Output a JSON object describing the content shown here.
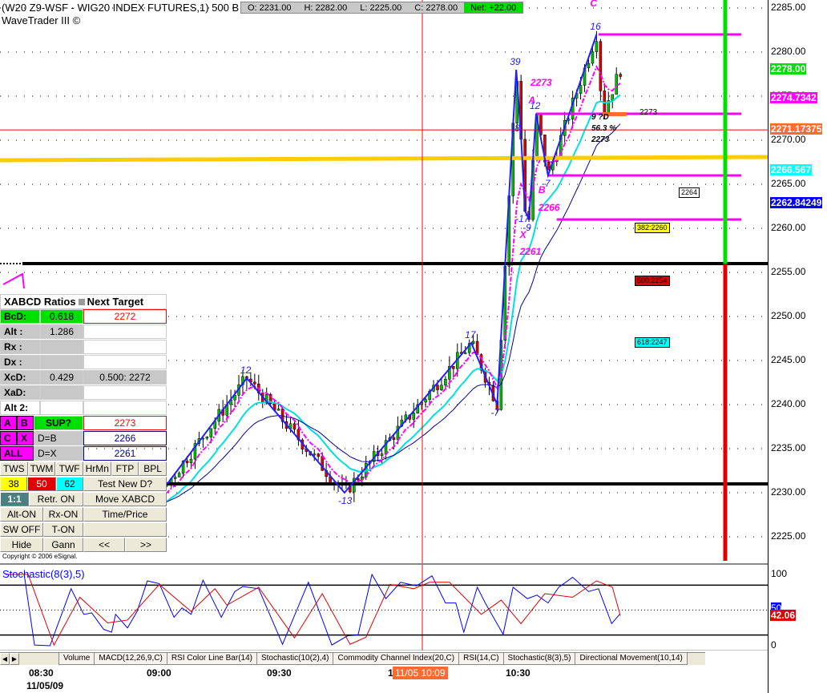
{
  "header": {
    "title": "(W20 Z9-WSF - WIG20 INDEX FUTURES,1) 500 B",
    "subtitle": "WaveTrader III ©",
    "open": "O: 2231.00",
    "high": "H: 2282.00",
    "low": "L: 2225.00",
    "close": "C: 2278.00",
    "net": "Net: +22.00"
  },
  "price_axis": {
    "ticks": [
      "2285.00",
      "2280.00",
      "2275.00",
      "2270.00",
      "2265.00",
      "2260.00",
      "2255.00",
      "2250.00",
      "2245.00",
      "2240.00",
      "2235.00",
      "2230.00",
      "2225.00"
    ],
    "tags": [
      {
        "text": "2278.00",
        "color": "#00e000",
        "value": 2278
      },
      {
        "text": "2274.7342",
        "color": "#ff00ff",
        "value": 2274.7342
      },
      {
        "text": "2271.17375",
        "color": "#ff6a30",
        "value": 2271.17375
      },
      {
        "text": "2266.567",
        "color": "#00ffff",
        "value": 2266.567
      },
      {
        "text": "2262.84249",
        "color": "#0000ff",
        "value": 2262.84249
      }
    ]
  },
  "level_boxes": [
    {
      "text": "2264",
      "color": "#ffffff",
      "value": 2264
    },
    {
      "text": "382:2260",
      "color": "#ffff00",
      "value": 2260
    },
    {
      "text": "500:2254",
      "color": "#e00000",
      "value": 2254
    },
    {
      "text": "618:2247",
      "color": "#00ffff",
      "value": 2247
    }
  ],
  "chart_data": {
    "type": "candlestick",
    "x_unit": "minutes from 08:30",
    "y_range": [
      2222,
      2286
    ],
    "wave": [
      [
        -8,
        2236
      ],
      [
        8,
        2228
      ],
      [
        20,
        2226
      ],
      [
        32,
        2231
      ],
      [
        52,
        2243
      ],
      [
        76.6,
        2230
      ],
      [
        108.5,
        2247
      ],
      [
        115,
        2240
      ],
      [
        119.8,
        2278
      ],
      [
        121,
        2270.5
      ],
      [
        122,
        2262
      ],
      [
        123,
        2261
      ],
      [
        124.8,
        2273
      ],
      [
        127.8,
        2266
      ],
      [
        140,
        2282
      ],
      [
        141.5,
        2273
      ],
      [
        146,
        2278
      ]
    ],
    "wave_labels": [
      {
        "text": "12",
        "m": 52,
        "p": 2243
      },
      {
        "text": "-13",
        "m": 76.6,
        "p": 2230
      },
      {
        "text": "17",
        "m": 108.5,
        "p": 2247
      },
      {
        "text": "-7",
        "m": 115,
        "p": 2240
      },
      {
        "text": "39",
        "m": 119.8,
        "p": 2278
      },
      {
        "text": "8",
        "m": 121,
        "p": 2270.5
      },
      {
        "text": "-17",
        "m": 121.2,
        "p": 2262
      },
      {
        "text": "-9",
        "m": 123,
        "p": 2261
      },
      {
        "text": "12",
        "m": 124.8,
        "p": 2273
      },
      {
        "text": "-7",
        "m": 127.8,
        "p": 2266
      },
      {
        "text": "16",
        "m": 140,
        "p": 2282
      }
    ],
    "pattern_labels": [
      {
        "text": "C",
        "m": 140,
        "p": 2285.5
      },
      {
        "text": "2273",
        "m": 125,
        "p": 2276.5
      },
      {
        "text": "A",
        "m": 124.5,
        "p": 2274.5
      },
      {
        "text": "B",
        "m": 127,
        "p": 2264.3
      },
      {
        "text": "2266",
        "m": 127,
        "p": 2262.3
      },
      {
        "text": "X",
        "m": 122.3,
        "p": 2259.2
      },
      {
        "text": "2261",
        "m": 122.3,
        "p": 2257.3
      }
    ],
    "d_labels": [
      "9 ?D",
      "56.3 %",
      "2273"
    ],
    "d_tag": "2273",
    "h_lines": [
      {
        "p": 2256,
        "color": "#000"
      },
      {
        "p": 2231,
        "color": "#000"
      }
    ],
    "fib_lines": [
      2282,
      2273,
      2266,
      2261
    ],
    "current_price": 2271.17375,
    "yellow_level": 2268,
    "time_ticks": [
      "08:30",
      "09:00",
      "09:30",
      "1",
      "10:30"
    ],
    "date": "11/05/09",
    "cursor_time": "11/05 10:09"
  },
  "stochastic": {
    "title": "Stochastic(8(3),5)",
    "axis": [
      "100",
      "50",
      "0"
    ],
    "value_tag": "42.06",
    "k": [
      [
        -8.7,
        100
      ],
      [
        -4,
        100
      ],
      [
        -1.4,
        1
      ],
      [
        2.5,
        0
      ],
      [
        7.8,
        80
      ],
      [
        11,
        44
      ],
      [
        13,
        46
      ],
      [
        16,
        23
      ],
      [
        18,
        19
      ],
      [
        19,
        44
      ],
      [
        22,
        25
      ],
      [
        24.4,
        48
      ],
      [
        27,
        91
      ],
      [
        30,
        87
      ],
      [
        33.7,
        40
      ],
      [
        35.7,
        53
      ],
      [
        38,
        44
      ],
      [
        41,
        92
      ],
      [
        45.6,
        40
      ],
      [
        49,
        76
      ],
      [
        51,
        83
      ],
      [
        55,
        80
      ],
      [
        61,
        2
      ],
      [
        67.5,
        89
      ],
      [
        73.4,
        1
      ],
      [
        77.4,
        14
      ],
      [
        80,
        15
      ],
      [
        83.5,
        100
      ],
      [
        87,
        66
      ],
      [
        90.7,
        89
      ],
      [
        94.7,
        84
      ],
      [
        98.6,
        98
      ],
      [
        102,
        60
      ],
      [
        104.6,
        60
      ],
      [
        106.6,
        19
      ],
      [
        110,
        82
      ],
      [
        112,
        60
      ],
      [
        116.5,
        16
      ],
      [
        119,
        82
      ],
      [
        122.6,
        66
      ],
      [
        125,
        71
      ],
      [
        127.8,
        60
      ],
      [
        130.5,
        82
      ],
      [
        134,
        96
      ],
      [
        138,
        76
      ],
      [
        140.5,
        80
      ],
      [
        143.8,
        31
      ],
      [
        145.8,
        44
      ]
    ],
    "d": [
      [
        -8.7,
        100
      ],
      [
        -3,
        100
      ],
      [
        3.5,
        1
      ],
      [
        10,
        68
      ],
      [
        17,
        32
      ],
      [
        22,
        36
      ],
      [
        30,
        86
      ],
      [
        38,
        48
      ],
      [
        44,
        80
      ],
      [
        47,
        57
      ],
      [
        55,
        82
      ],
      [
        64,
        11
      ],
      [
        71,
        73
      ],
      [
        78,
        2
      ],
      [
        82,
        12
      ],
      [
        88,
        86
      ],
      [
        94,
        80
      ],
      [
        98,
        89
      ],
      [
        103,
        89
      ],
      [
        111,
        44
      ],
      [
        116,
        64
      ],
      [
        121,
        31
      ],
      [
        127,
        73
      ],
      [
        134,
        68
      ],
      [
        140,
        91
      ],
      [
        144,
        82
      ],
      [
        146,
        42
      ]
    ]
  },
  "panel": {
    "title": "XABCD Ratios",
    "next_target": "Next Target",
    "rows": [
      {
        "label": "BcD:",
        "value": "0.618",
        "right": "2272"
      },
      {
        "label": "Alt  :",
        "value": "1.286",
        "right": ""
      },
      {
        "label": "Rx  :",
        "value": "",
        "right": ""
      },
      {
        "label": "Dx  :",
        "value": "",
        "right": ""
      },
      {
        "label": "XcD:",
        "value": "0.429",
        "right": "0.500: 2272"
      },
      {
        "label": "XaD:",
        "value": "",
        "right": ""
      },
      {
        "label": "Alt 2:",
        "value": "",
        "right": ""
      }
    ],
    "a": "A",
    "b": "B",
    "c": "C",
    "x": "X",
    "all": "ALL",
    "sup": "SUP?",
    "sup_val": "2273",
    "db": "D=B",
    "db_val": "2266",
    "dx": "D=X",
    "dx_val": "2261",
    "buttons1": [
      "TWS",
      "TWM",
      "TWF",
      "HrMn",
      "FTP",
      "BPL"
    ],
    "num1": "38",
    "num2": "50",
    "num3": "62",
    "test": "Test New D?",
    "ratio": "1:1",
    "retr": "Retr. ON",
    "move": "Move XABCD",
    "alt_on": "Alt-ON",
    "rx_on": "Rx-ON",
    "timeprice": "Time/Price",
    "sw_off": "SW OFF",
    "t_on": "T-ON",
    "hide": "Hide",
    "gann": "Gann",
    "prev": "<<",
    "next": ">>",
    "copyright": "Copyright © 2006 eSignal."
  },
  "tabs": [
    "Volume",
    "MACD(12,26,9,C)",
    "RSI Color Line Bar(14)",
    "Stochastic(10(2),4)",
    "Commodity Channel Index(20,C)",
    "RSI(14,C)",
    "Stochastic(8(3),5)",
    "Directional Movement(10,14)"
  ]
}
